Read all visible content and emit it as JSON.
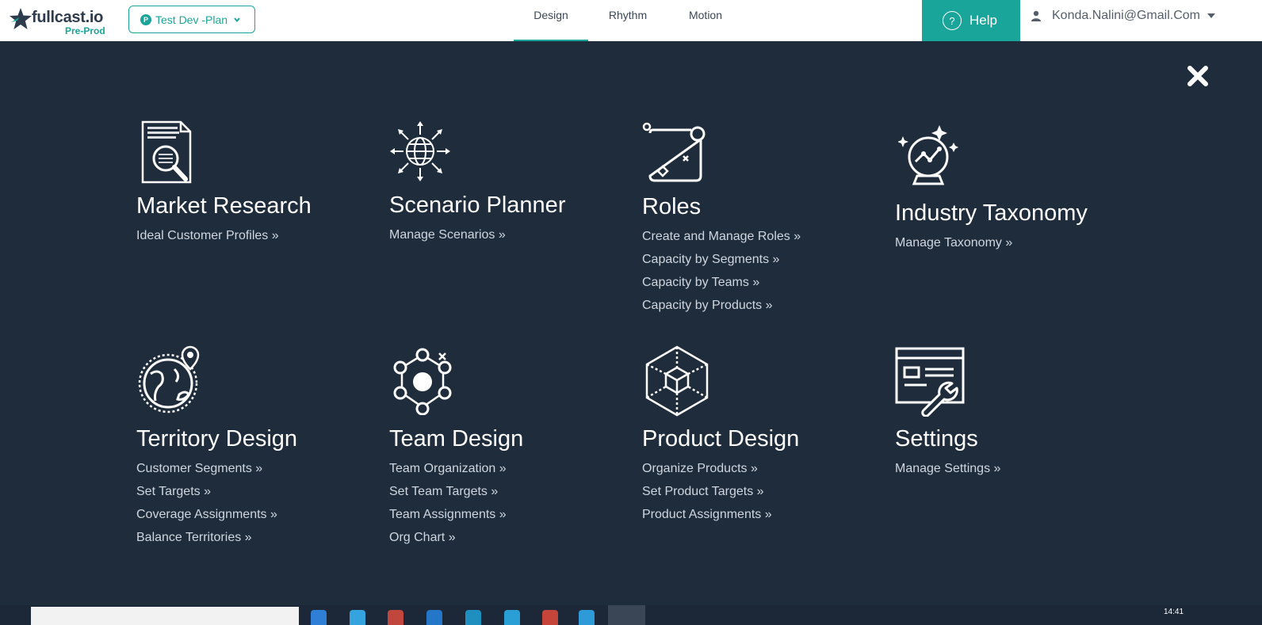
{
  "header": {
    "logo_name": "fullcast.io",
    "logo_env": "Pre-Prod",
    "plan_badge": "P",
    "plan_label": "Test Dev -Plan",
    "tabs": [
      {
        "label": "Design",
        "active": true
      },
      {
        "label": "Rhythm",
        "active": false
      },
      {
        "label": "Motion",
        "active": false
      }
    ],
    "help_label": "Help",
    "help_glyph": "?",
    "user_label": "Konda.Nalini@Gmail.Com"
  },
  "modules": [
    {
      "title": "Market Research",
      "icon": "document-search-icon",
      "links": [
        "Ideal Customer Profiles »"
      ]
    },
    {
      "title": "Scenario Planner",
      "icon": "globe-arrows-icon",
      "links": [
        "Manage Scenarios »"
      ]
    },
    {
      "title": "Roles",
      "icon": "roles-board-icon",
      "links": [
        "Create and Manage Roles »",
        "Capacity by Segments »",
        "Capacity by Teams »",
        "Capacity by Products »"
      ]
    },
    {
      "title": "Industry Taxonomy",
      "icon": "crystal-ball-icon",
      "links": [
        "Manage Taxonomy »"
      ]
    },
    {
      "title": "Territory Design",
      "icon": "globe-pin-icon",
      "links": [
        "Customer Segments »",
        "Set Targets »",
        "Coverage Assignments »",
        "Balance Territories »"
      ]
    },
    {
      "title": "Team Design",
      "icon": "network-icon",
      "links": [
        "Team Organization »",
        "Set Team Targets »",
        "Team Assignments »",
        "Org Chart »"
      ]
    },
    {
      "title": "Product Design",
      "icon": "cube-icon",
      "links": [
        "Organize Products »",
        "Set Product Targets »",
        "Product Assignments »"
      ]
    },
    {
      "title": "Settings",
      "icon": "settings-window-icon",
      "links": [
        "Manage Settings »"
      ]
    }
  ],
  "taskbar": {
    "time": "14:41"
  },
  "colors": {
    "accent": "#1aa59a",
    "overlay": "#1f2c3c",
    "link": "#cfd6df",
    "title": "#ffffff"
  }
}
